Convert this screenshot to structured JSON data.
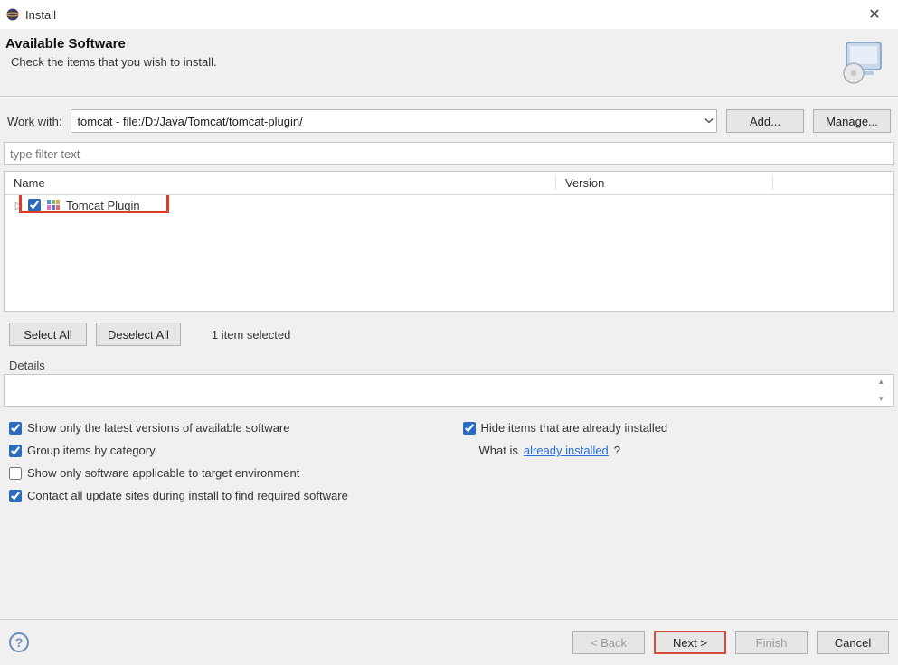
{
  "title": "Install",
  "header": {
    "heading": "Available Software",
    "subtitle": "Check the items that you wish to install."
  },
  "workwith": {
    "label": "Work with:",
    "value": "tomcat - file:/D:/Java/Tomcat/tomcat-plugin/",
    "add": "Add...",
    "manage": "Manage..."
  },
  "filter": {
    "placeholder": "type filter text"
  },
  "table": {
    "columns": {
      "name": "Name",
      "version": "Version"
    },
    "rows": [
      {
        "label": "Tomcat Plugin",
        "checked": true
      }
    ]
  },
  "selection": {
    "select_all": "Select All",
    "deselect_all": "Deselect All",
    "status": "1 item selected"
  },
  "details": {
    "legend": "Details"
  },
  "options": {
    "show_latest": {
      "label": "Show only the latest versions of available software",
      "checked": true
    },
    "group_category": {
      "label": "Group items by category",
      "checked": true
    },
    "show_applicable": {
      "label": "Show only software applicable to target environment",
      "checked": false
    },
    "contact_sites": {
      "label": "Contact all update sites during install to find required software",
      "checked": true
    },
    "hide_installed": {
      "label": "Hide items that are already installed",
      "checked": true
    },
    "whatis_prefix": "What is ",
    "whatis_link": "already installed",
    "whatis_suffix": "?"
  },
  "footer": {
    "back": "< Back",
    "next": "Next >",
    "finish": "Finish",
    "cancel": "Cancel"
  }
}
